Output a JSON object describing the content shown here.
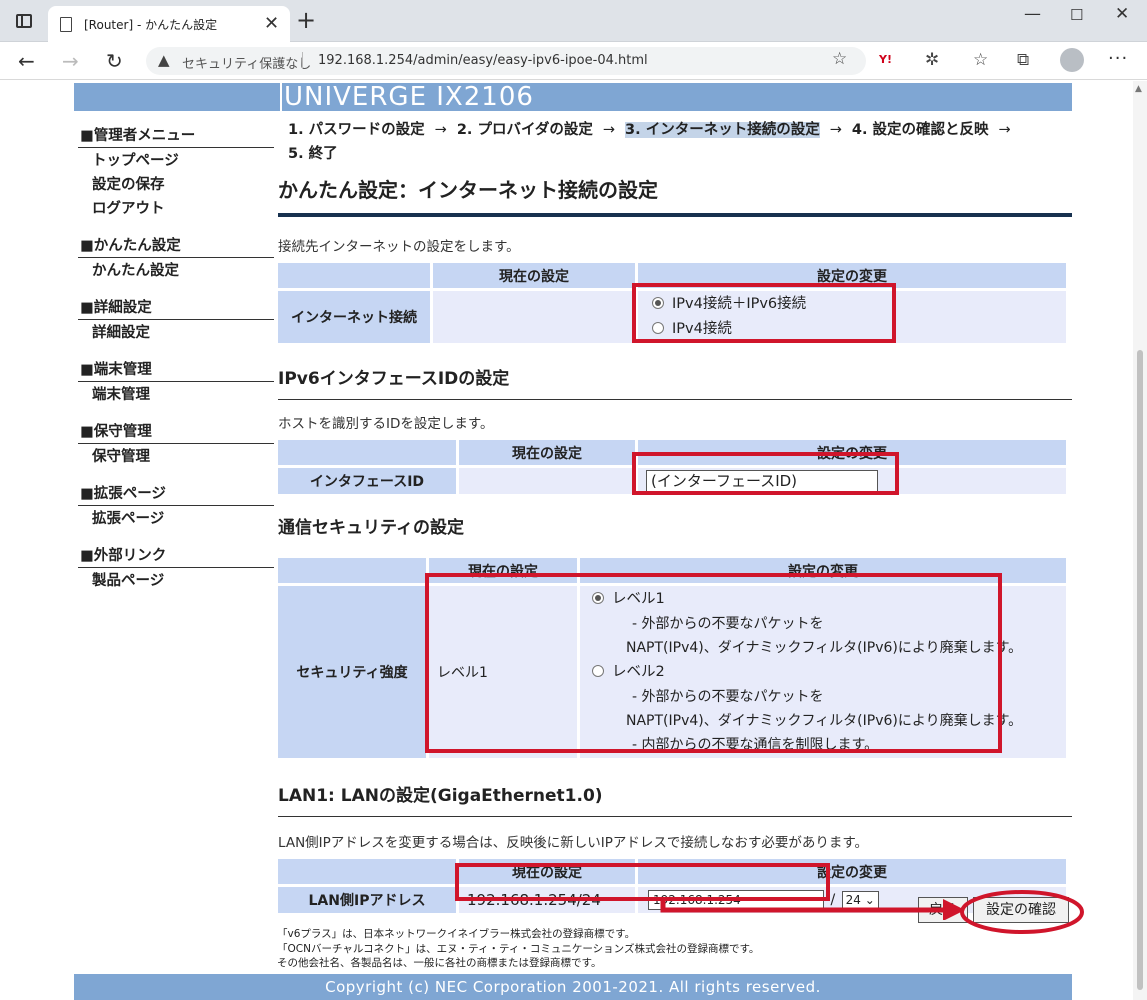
{
  "browser": {
    "tab_title": "[Router] - かんたん設定",
    "close_tab": "✕",
    "new_tab": "+",
    "security_label": "セキュリティ保護なし",
    "url": "192.168.1.254/admin/easy/easy-ipv6-ipoe-04.html"
  },
  "banner": {
    "title": "UNIVERGE IX2106"
  },
  "sidebar": [
    {
      "head": "■管理者メニュー",
      "links": [
        "トップページ",
        "設定の保存",
        "ログアウト"
      ]
    },
    {
      "head": "■かんたん設定",
      "links": [
        "かんたん設定"
      ]
    },
    {
      "head": "■詳細設定",
      "links": [
        "詳細設定"
      ]
    },
    {
      "head": "■端末管理",
      "links": [
        "端末管理"
      ]
    },
    {
      "head": "■保守管理",
      "links": [
        "保守管理"
      ]
    },
    {
      "head": "■拡張ページ",
      "links": [
        "拡張ページ"
      ]
    },
    {
      "head": "■外部リンク",
      "links": [
        "製品ページ"
      ]
    }
  ],
  "steps": [
    "1. パスワードの設定",
    "2. プロバイダの設定",
    "3. インターネット接続の設定",
    "4. 設定の確認と反映",
    "5. 終了"
  ],
  "step_arrow": "→",
  "page_title": "かんたん設定：インターネット接続の設定",
  "table_headers": {
    "current": "現在の設定",
    "change": "設定の変更"
  },
  "internet": {
    "description": "接続先インターネットの設定をします。",
    "label": "インターネット接続",
    "current": "",
    "options": [
      "IPv4接続＋IPv6接続",
      "IPv4接続"
    ],
    "selected": 0
  },
  "ipv6_interface": {
    "title": "IPv6インタフェースIDの設定",
    "description": "ホストを識別するIDを設定します。",
    "label": "インタフェースID",
    "current": "",
    "value": "(インターフェースID)"
  },
  "security": {
    "title": "通信セキュリティの設定",
    "label": "セキュリティ強度",
    "current": "レベル1",
    "level1": {
      "label": "レベル1",
      "line1": "- 外部からの不要なパケットを",
      "line2": "NAPT(IPv4)、ダイナミックフィルタ(IPv6)により廃棄します。"
    },
    "level2": {
      "label": "レベル2",
      "line1": "- 外部からの不要なパケットを",
      "line2": "NAPT(IPv4)、ダイナミックフィルタ(IPv6)により廃棄します。",
      "line3": "- 内部からの不要な通信を制限します。"
    },
    "selected": "レベル1"
  },
  "lan": {
    "title": "LAN1: LANの設定(GigaEthernet1.0)",
    "description": "LAN側IPアドレスを変更する場合は、反映後に新しいIPアドレスで接続しなおす必要があります。",
    "label": "LAN側IPアドレス",
    "current": "192.168.1.254/24",
    "ip_value": "192.168.1.254",
    "slash": "/",
    "prefix": "24 ⌄"
  },
  "buttons": {
    "back": "戻る",
    "confirm": "設定の確認"
  },
  "footer_notes": [
    "「v6プラス」は、日本ネットワークイネイブラー株式会社の登録商標です。",
    "「OCNバーチャルコネクト」は、エヌ・ティ・ティ・コミュニケーションズ株式会社の登録商標です。",
    "その他会社名、各製品名は、一般に各社の商標または登録商標です。"
  ],
  "copyright": "Copyright (c) NEC Corporation 2001-2021. All rights reserved.",
  "colors": {
    "banner": "#7fa6d3",
    "highlight_red": "#d0152b",
    "table_header": "#c6d6f3",
    "table_cell": "#e8ebfa",
    "title_rule": "#17314f"
  }
}
